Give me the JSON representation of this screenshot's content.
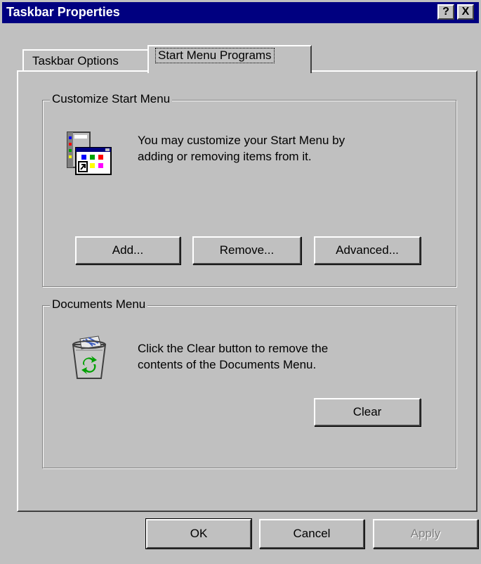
{
  "window": {
    "title": "Taskbar Properties",
    "help_label": "?",
    "close_label": "X"
  },
  "tabs": [
    {
      "label": "Taskbar Options",
      "active": false
    },
    {
      "label": "Start Menu Programs",
      "active": true
    }
  ],
  "customize_group": {
    "legend": "Customize Start Menu",
    "description_line1": "You may customize your Start Menu by",
    "description_line2": "adding or removing items from it.",
    "icon": "start-menu-customize-icon",
    "buttons": {
      "add": "Add...",
      "remove": "Remove...",
      "advanced": "Advanced..."
    }
  },
  "documents_group": {
    "legend": "Documents Menu",
    "description_line1": "Click the Clear button to remove the",
    "description_line2": "contents of the Documents Menu.",
    "icon": "recycle-bin-icon",
    "clear_label": "Clear"
  },
  "footer": {
    "ok": "OK",
    "cancel": "Cancel",
    "apply": "Apply",
    "apply_enabled": false
  },
  "colors": {
    "titlebar": "#000080",
    "face": "#c0c0c0"
  }
}
